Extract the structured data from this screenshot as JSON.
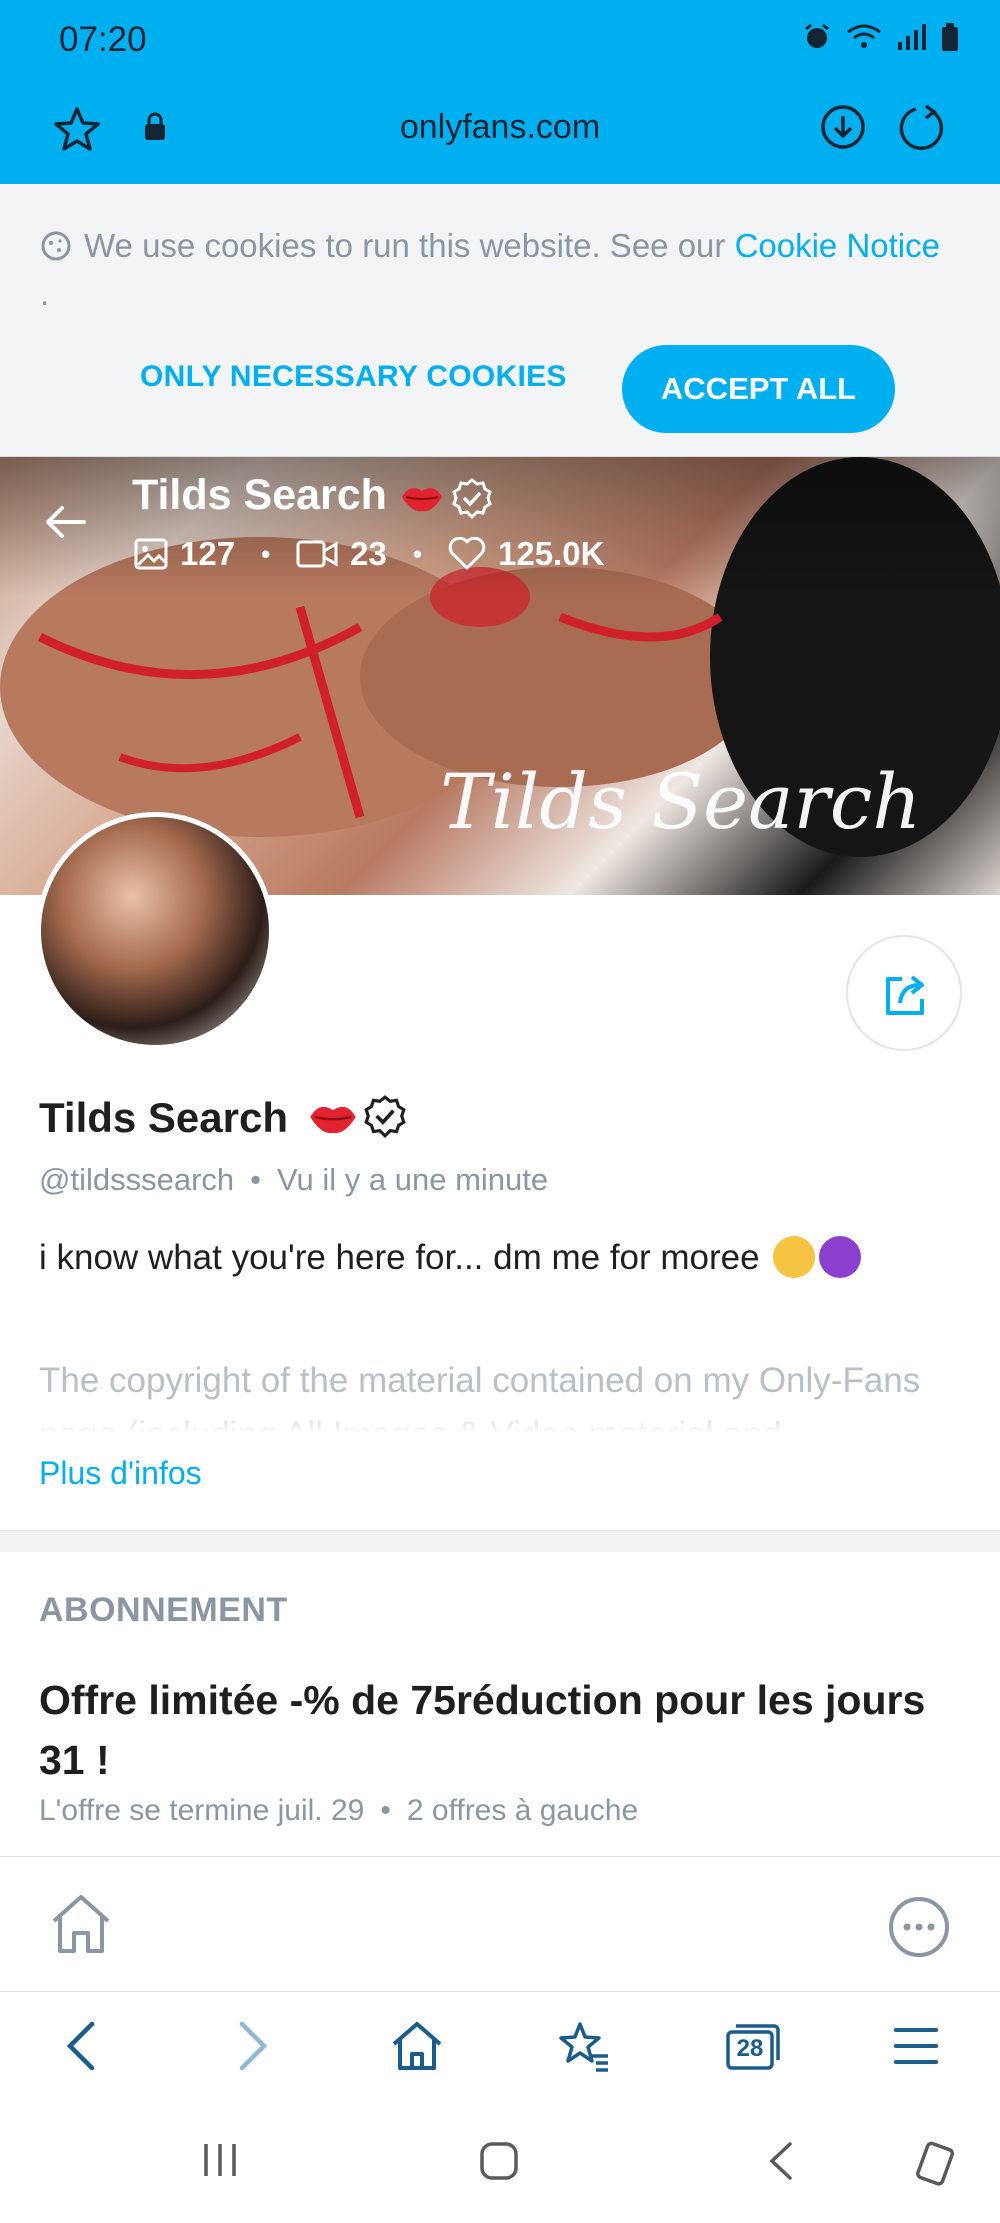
{
  "status_bar": {
    "time": "07:20"
  },
  "browser": {
    "url": "onlyfans.com",
    "tab_count": "28"
  },
  "cookie_banner": {
    "text": "We use cookies to run this website. See our",
    "link": "Cookie Notice",
    "link_suffix": " .",
    "necessary_button": "ONLY NECESSARY COOKIES",
    "accept_button": "ACCEPT ALL"
  },
  "banner": {
    "name": "Tilds Search",
    "photos": "127",
    "videos": "23",
    "likes": "125.0K",
    "script": "Tilds Search"
  },
  "profile": {
    "name": "Tilds Search",
    "handle": "@tildsssearch",
    "last_seen": "Vu  il y a une minute",
    "bio": "i know what you're here for... dm me for moree",
    "copyright": "The copyright of the material contained on my Only-Fans page (including All Images & Video material and",
    "more_link": "Plus d'infos"
  },
  "subscription": {
    "label": "ABONNEMENT",
    "title": "Offre limitée -% de 75réduction pour les jours 31 !",
    "ends": "L'offre se termine juil. 29",
    "remaining": "2 offres à gauche"
  },
  "colors": {
    "brand": "#00aff0",
    "muted": "#8a96a3",
    "red": "#e0232e"
  }
}
